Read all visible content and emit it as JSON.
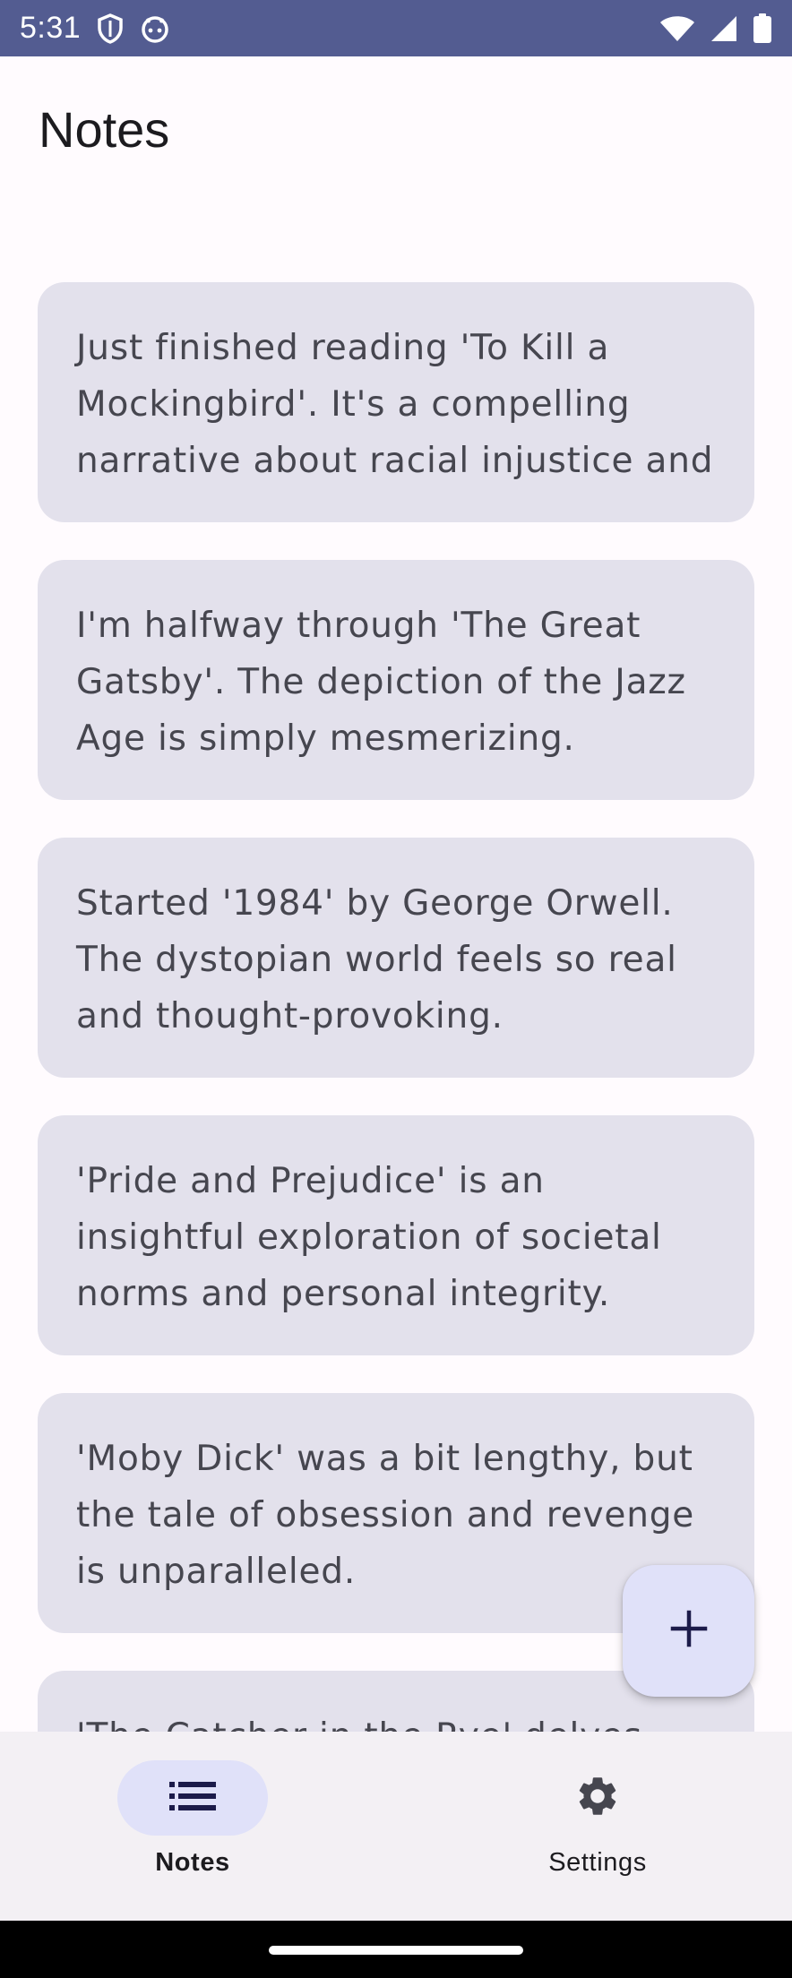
{
  "status_bar": {
    "time": "5:31",
    "icons": [
      "shield-icon",
      "android-face-icon",
      "wifi-icon",
      "signal-icon",
      "battery-icon"
    ]
  },
  "header": {
    "title": "Notes"
  },
  "notes": [
    {
      "text": "Just finished reading 'To Kill a Mockingbird'. It's a compelling narrative about racial injustice and"
    },
    {
      "text": "I'm halfway through 'The Great Gatsby'. The depiction of the Jazz Age is simply mesmerizing."
    },
    {
      "text": "Started '1984' by George Orwell. The dystopian world feels so real and thought-provoking."
    },
    {
      "text": "'Pride and Prejudice' is an insightful exploration of societal norms and personal integrity."
    },
    {
      "text": "'Moby Dick' was a bit lengthy, but the tale of obsession and revenge is unparalleled."
    },
    {
      "text": "'The Catcher in the Rye' delves deep"
    }
  ],
  "fab": {
    "icon": "plus-icon"
  },
  "bottom_nav": {
    "items": [
      {
        "label": "Notes",
        "icon": "list-icon",
        "active": true
      },
      {
        "label": "Settings",
        "icon": "gear-icon",
        "active": false
      }
    ]
  },
  "colors": {
    "status_bar": "#535c91",
    "card": "#e3e1ec",
    "fab": "#e0e1f9",
    "nav_background": "#f3f0f4",
    "active_pill": "#e0e1f9"
  }
}
